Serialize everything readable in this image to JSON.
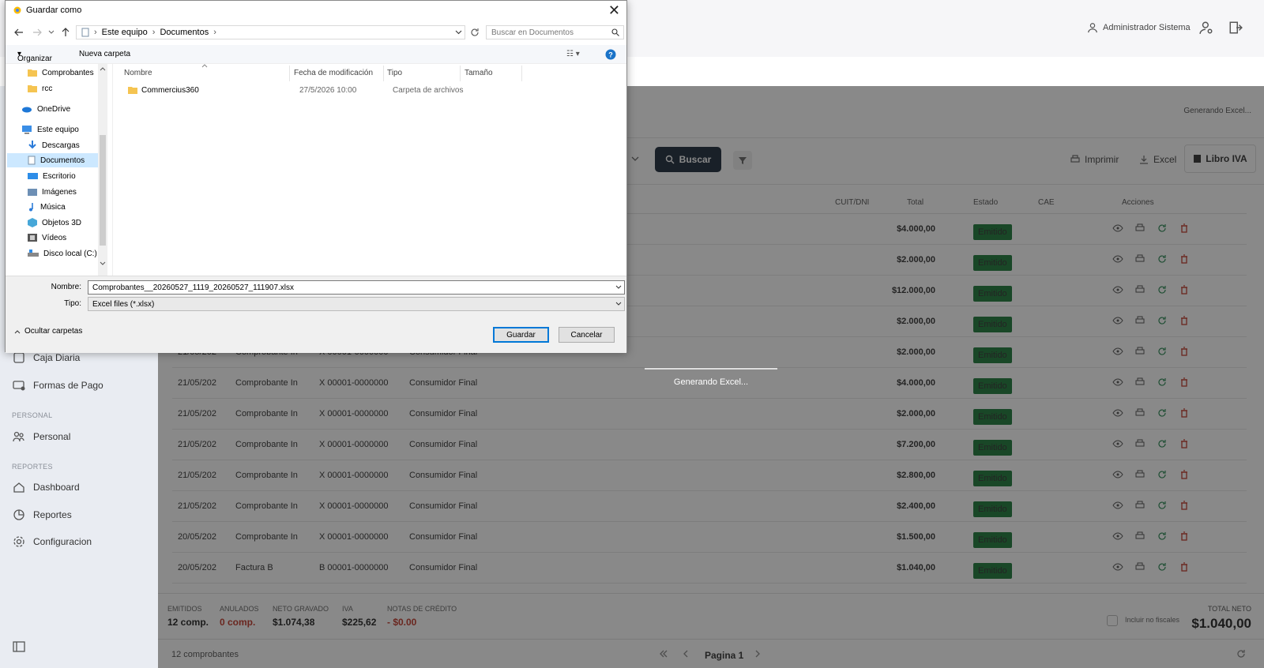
{
  "header": {
    "user": "Administrador Sistema"
  },
  "status_text": "Generando Excel...",
  "sidebar": {
    "items_top": [
      {
        "label": "Caja Diaria"
      },
      {
        "label": "Formas de Pago"
      }
    ],
    "section_personal": "PERSONAL",
    "item_personal": "Personal",
    "section_reportes": "REPORTES",
    "items_reportes": [
      {
        "label": "Dashboard"
      },
      {
        "label": "Reportes"
      },
      {
        "label": "Configuracion"
      }
    ]
  },
  "toolbar": {
    "search_label": "Buscar",
    "print_label": "Imprimir",
    "excel_label": "Excel",
    "libro_label": "Libro IVA"
  },
  "table": {
    "headers": {
      "cuit": "CUIT/DNI",
      "total": "Total",
      "estado": "Estado",
      "cae": "CAE",
      "acciones": "Acciones"
    },
    "rows": [
      {
        "fecha": "",
        "tipo": "",
        "numero": "",
        "cliente": "",
        "total": "$4.000,00",
        "estado": "Emitido"
      },
      {
        "fecha": "",
        "tipo": "",
        "numero": "",
        "cliente": "",
        "total": "$2.000,00",
        "estado": "Emitido"
      },
      {
        "fecha": "",
        "tipo": "",
        "numero": "",
        "cliente": "",
        "total": "$12.000,00",
        "estado": "Emitido"
      },
      {
        "fecha": "",
        "tipo": "",
        "numero": "",
        "cliente": "",
        "total": "$2.000,00",
        "estado": "Emitido"
      },
      {
        "fecha": "21/05/202",
        "tipo": "Comprobante In",
        "numero": "X 00001-0000000",
        "cliente": "Consumidor Final",
        "total": "$2.000,00",
        "estado": "Emitido"
      },
      {
        "fecha": "21/05/202",
        "tipo": "Comprobante In",
        "numero": "X 00001-0000000",
        "cliente": "Consumidor Final",
        "total": "$4.000,00",
        "estado": "Emitido"
      },
      {
        "fecha": "21/05/202",
        "tipo": "Comprobante In",
        "numero": "X 00001-0000000",
        "cliente": "Consumidor Final",
        "total": "$2.000,00",
        "estado": "Emitido"
      },
      {
        "fecha": "21/05/202",
        "tipo": "Comprobante In",
        "numero": "X 00001-0000000",
        "cliente": "Consumidor Final",
        "total": "$7.200,00",
        "estado": "Emitido"
      },
      {
        "fecha": "21/05/202",
        "tipo": "Comprobante In",
        "numero": "X 00001-0000000",
        "cliente": "Consumidor Final",
        "total": "$2.800,00",
        "estado": "Emitido"
      },
      {
        "fecha": "21/05/202",
        "tipo": "Comprobante In",
        "numero": "X 00001-0000000",
        "cliente": "Consumidor Final",
        "total": "$2.400,00",
        "estado": "Emitido"
      },
      {
        "fecha": "20/05/202",
        "tipo": "Comprobante In",
        "numero": "X 00001-0000000",
        "cliente": "Consumidor Final",
        "total": "$1.500,00",
        "estado": "Emitido"
      },
      {
        "fecha": "20/05/202",
        "tipo": "Factura B",
        "numero": "B 00001-0000000",
        "cliente": "Consumidor Final",
        "total": "$1.040,00",
        "estado": "Emitido"
      }
    ]
  },
  "footer": {
    "stats": [
      {
        "label": "EMITIDOS",
        "value": "12  comp.",
        "color": "#222"
      },
      {
        "label": "ANULADOS",
        "value": "0  comp.",
        "color": "#c0392b"
      },
      {
        "label": "NETO GRAVADO",
        "value": "$1.074,38",
        "color": "#222"
      },
      {
        "label": "IVA",
        "value": "$225,62",
        "color": "#222"
      },
      {
        "label": "NOTAS DE CRÉDITO",
        "value": "- $0.00",
        "color": "#c0392b"
      }
    ],
    "include_label": "Incluir no fiscales",
    "total_label": "TOTAL NETO",
    "total_value": "$1.040,00"
  },
  "bottom": {
    "count": "12 comprobantes",
    "page": "Pagina 1"
  },
  "dialog": {
    "title": "Guardar como",
    "address": [
      "Este equipo",
      "Documentos"
    ],
    "search_placeholder": "Buscar en Documentos",
    "organize": "Organizar",
    "new_folder": "Nueva carpeta",
    "nav": [
      "Comprobantes",
      "rcc",
      "OneDrive",
      "Este equipo",
      "Descargas",
      "Documentos",
      "Escritorio",
      "Imágenes",
      "Música",
      "Objetos 3D",
      "Vídeos",
      "Disco local (C:)"
    ],
    "columns": [
      "Nombre",
      "Fecha de modificación",
      "Tipo",
      "Tamaño"
    ],
    "files": [
      {
        "name": "Commercius360",
        "date": "27/5/2026 10:00",
        "type": "Carpeta de archivos"
      }
    ],
    "name_label": "Nombre:",
    "name_value": "Comprobantes__20260527_1119_20260527_111907.xlsx",
    "type_label": "Tipo:",
    "type_value": "Excel files (*.xlsx)",
    "hide_folders": "Ocultar carpetas",
    "save": "Guardar",
    "cancel": "Cancelar"
  }
}
